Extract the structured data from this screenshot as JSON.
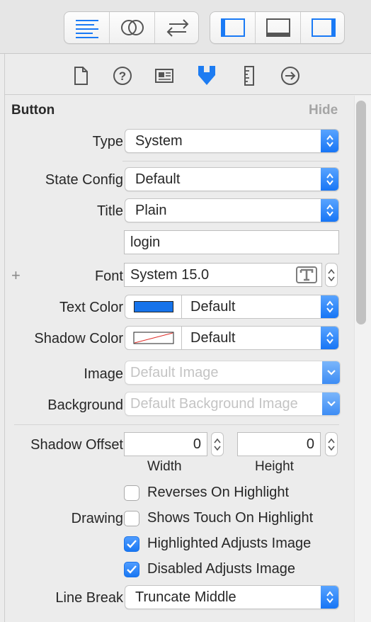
{
  "toolbar": {
    "editor_icons": [
      "standard-editor-icon",
      "assistant-editor-icon",
      "version-editor-icon"
    ],
    "view_icons": [
      "navigator-toggle-icon",
      "debug-area-toggle-icon",
      "utilities-toggle-icon"
    ]
  },
  "inspector_tabs": [
    {
      "icon": "file-inspector-icon",
      "selected": false
    },
    {
      "icon": "quick-help-icon",
      "selected": false
    },
    {
      "icon": "identity-inspector-icon",
      "selected": false
    },
    {
      "icon": "attributes-inspector-icon",
      "selected": true
    },
    {
      "icon": "size-inspector-icon",
      "selected": false
    },
    {
      "icon": "connections-inspector-icon",
      "selected": false
    }
  ],
  "section": {
    "title": "Button",
    "hide_label": "Hide"
  },
  "fields": {
    "type": {
      "label": "Type",
      "value": "System"
    },
    "state_config": {
      "label": "State Config",
      "value": "Default"
    },
    "title": {
      "label": "Title",
      "value": "Plain"
    },
    "title_text": {
      "value": "login"
    },
    "font": {
      "label": "Font",
      "value": "System 15.0",
      "add_symbol": "+"
    },
    "text_color": {
      "label": "Text Color",
      "value": "Default",
      "swatch": "#1673ea"
    },
    "shadow_color": {
      "label": "Shadow Color",
      "value": "Default"
    },
    "image": {
      "label": "Image",
      "placeholder": "Default Image"
    },
    "background": {
      "label": "Background",
      "placeholder": "Default Background Image"
    },
    "shadow_offset": {
      "label": "Shadow Offset",
      "width": "0",
      "height": "0",
      "width_label": "Width",
      "height_label": "Height"
    },
    "drawing": {
      "label": "Drawing",
      "options": [
        {
          "label": "Reverses On Highlight",
          "checked": false
        },
        {
          "label": "Shows Touch On Highlight",
          "checked": false
        },
        {
          "label": "Highlighted Adjusts Image",
          "checked": true
        },
        {
          "label": "Disabled Adjusts Image",
          "checked": true
        }
      ]
    },
    "line_break": {
      "label": "Line Break",
      "value": "Truncate Middle"
    }
  },
  "colors": {
    "accent": "#1a7af5",
    "selected_tab": "#1d7cf2"
  }
}
